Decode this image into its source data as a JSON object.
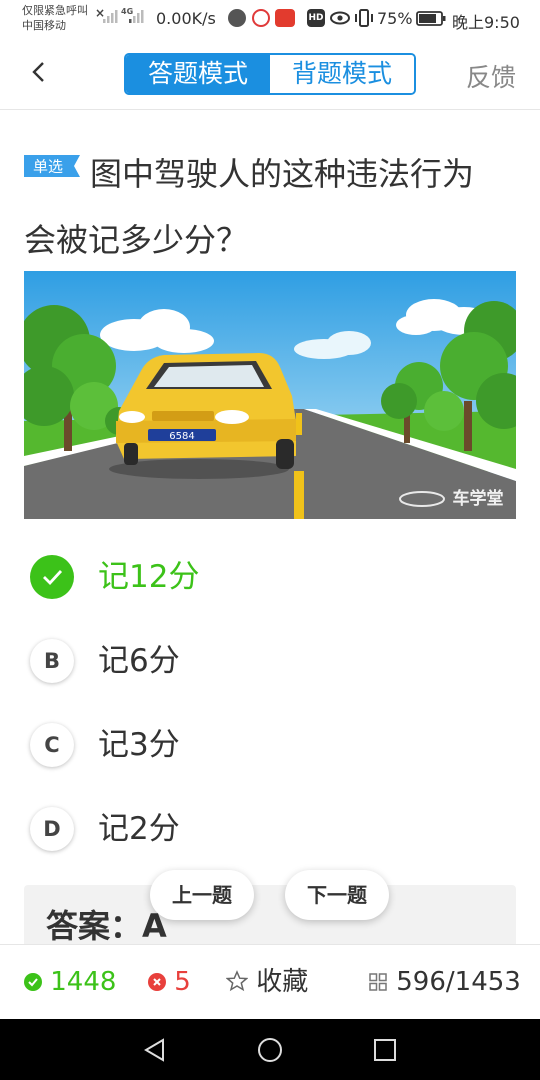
{
  "status_bar": {
    "line1": "仅限紧急呼叫",
    "line2": "中国移动",
    "network": "4G",
    "speed": "0.00K/s",
    "hd": "HD",
    "battery": "75%",
    "time": "晚上9:50"
  },
  "header": {
    "back_icon": "chevron-left-icon",
    "modes": [
      "答题模式",
      "背题模式"
    ],
    "active_mode": "答题模式",
    "feedback": "反馈"
  },
  "question": {
    "type_tag": "单选",
    "text": "图中驾驶人的这种违法行为会被记多少分？",
    "image": {
      "plate": "6584",
      "watermark": "车学堂"
    }
  },
  "options": [
    {
      "letter": "A",
      "text": "记12分",
      "correct": true
    },
    {
      "letter": "B",
      "text": "记6分",
      "correct": false
    },
    {
      "letter": "C",
      "text": "记3分",
      "correct": false
    },
    {
      "letter": "D",
      "text": "记2分",
      "correct": false
    }
  ],
  "answer": {
    "text": "答案：A"
  },
  "nav": {
    "prev": "上一题",
    "next": "下一题"
  },
  "bottom_bar": {
    "correct_count": "1448",
    "wrong_count": "5",
    "favorite": "收藏",
    "progress": "596/1453"
  },
  "colors": {
    "brand": "#1b8fe0",
    "correct": "#3cc219",
    "wrong": "#e8403c"
  }
}
